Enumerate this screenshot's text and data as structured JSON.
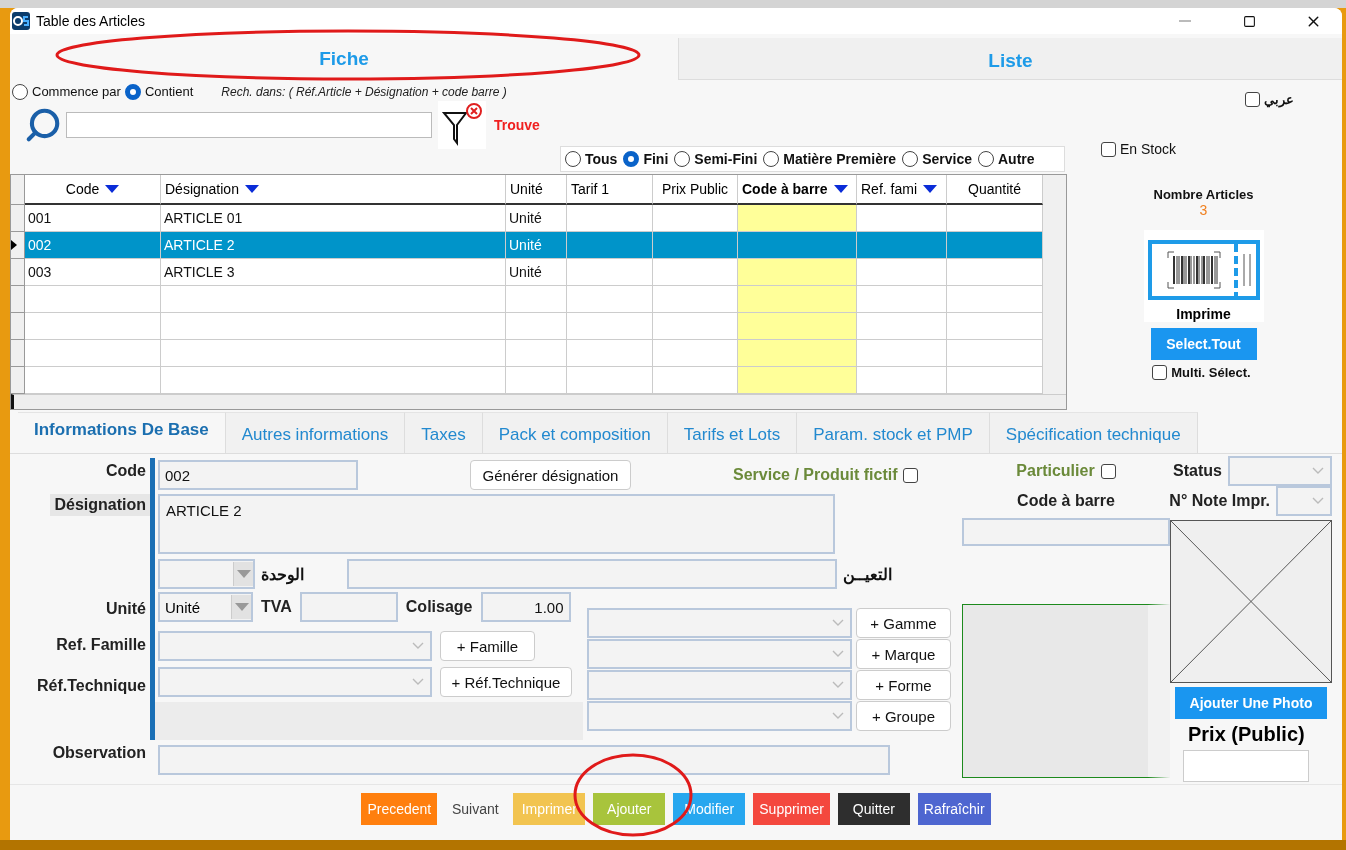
{
  "window": {
    "title": "Table des Articles"
  },
  "main_tabs": [
    {
      "label": "Fiche",
      "selected": true
    },
    {
      "label": "Liste",
      "selected": false
    }
  ],
  "search": {
    "modes": [
      {
        "label": "Commence par",
        "selected": false
      },
      {
        "label": "Contient",
        "selected": true
      }
    ],
    "hint": "Rech. dans: ( Réf.Article + Désignation + code barre )",
    "result": "Trouve"
  },
  "arabic_toggle": {
    "label": "عربي",
    "checked": false
  },
  "types": [
    {
      "label": "Tous",
      "selected": false
    },
    {
      "label": "Fini",
      "selected": true
    },
    {
      "label": "Semi-Fini",
      "selected": false
    },
    {
      "label": "Matière Première",
      "selected": false
    },
    {
      "label": "Service",
      "selected": false
    },
    {
      "label": "Autre",
      "selected": false
    }
  ],
  "in_stock": {
    "label": "En Stock",
    "checked": false
  },
  "table": {
    "columns": [
      {
        "label": "Code",
        "filter": true,
        "highlighted": false
      },
      {
        "label": "Désignation",
        "filter": true,
        "highlighted": false
      },
      {
        "label": "Unité",
        "filter": false,
        "highlighted": false
      },
      {
        "label": "Tarif 1",
        "filter": false,
        "highlighted": false
      },
      {
        "label": "Prix Public",
        "filter": false,
        "highlighted": false
      },
      {
        "label": "Code à barre",
        "filter": true,
        "highlighted": true
      },
      {
        "label": "Ref. fami",
        "filter": true,
        "highlighted": false
      },
      {
        "label": "Quantité",
        "filter": false,
        "highlighted": false
      }
    ],
    "rows": [
      {
        "cells": [
          "001",
          "ARTICLE 01",
          "Unité"
        ],
        "selected": false
      },
      {
        "cells": [
          "002",
          "ARTICLE 2",
          "Unité"
        ],
        "selected": true
      },
      {
        "cells": [
          "003",
          "ARTICLE 3",
          "Unité"
        ],
        "selected": false
      }
    ]
  },
  "summary": {
    "label": "Nombre Articles",
    "count": "3"
  },
  "print_label": "Imprime",
  "select_all": "Select.Tout",
  "multi_select": {
    "label": "Multi. Sélect.",
    "checked": false
  },
  "detail_tabs": [
    {
      "label": "Informations De Base",
      "selected": true
    },
    {
      "label": "Autres informations",
      "selected": false
    },
    {
      "label": "Taxes",
      "selected": false
    },
    {
      "label": "Pack et composition",
      "selected": false
    },
    {
      "label": "Tarifs et Lots",
      "selected": false
    },
    {
      "label": "Param. stock et PMP",
      "selected": false
    },
    {
      "label": "Spécification technique",
      "selected": false
    }
  ],
  "form": {
    "code": {
      "label": "Code",
      "value": "002"
    },
    "generate_button": "Générer désignation",
    "service_fictif": {
      "label": "Service / Produit fictif",
      "checked": false
    },
    "particulier": {
      "label": "Particulier",
      "checked": false
    },
    "designation": {
      "label": "Désignation",
      "value": "ARTICLE 2"
    },
    "unit_ar_label": "الوحدة",
    "designation_ar_label": "التعيــن",
    "unit": {
      "label": "Unité",
      "value": "Unité"
    },
    "tva": {
      "label": "TVA"
    },
    "colisage": {
      "label": "Colisage",
      "value": "1.00"
    },
    "famille": {
      "label": "Ref. Famille",
      "button": "+ Famille"
    },
    "technique": {
      "label": "Réf.Technique",
      "button": "+ Réf.Technique"
    },
    "extra_buttons": [
      "+ Gamme",
      "+ Marque",
      "+ Forme",
      "+ Groupe"
    ],
    "observation": {
      "label": "Observation"
    },
    "barcode": {
      "label": "Code à barre"
    },
    "status": {
      "label": "Status"
    },
    "note": {
      "label": "N° Note Impr."
    },
    "photo_button": "Ajouter Une Photo",
    "price": {
      "label": "Prix (Public)"
    }
  },
  "actions": [
    {
      "label": "Precedent",
      "kind": "filled",
      "color": "#ff7f0e"
    },
    {
      "label": "Suivant",
      "kind": "flat",
      "color": "#f7f7f7"
    },
    {
      "label": "Imprimer",
      "kind": "filled",
      "color": "#f2c450"
    },
    {
      "label": "Ajouter",
      "kind": "filled",
      "color": "#a8c43c"
    },
    {
      "label": "Modifier",
      "kind": "filled",
      "color": "#27a7ef"
    },
    {
      "label": "Supprimer",
      "kind": "filled",
      "color": "#f4483e"
    },
    {
      "label": "Quitter",
      "kind": "filled",
      "color": "#2e2e2e"
    },
    {
      "label": "Rafraîchir",
      "kind": "filled",
      "color": "#4e66d0"
    }
  ]
}
